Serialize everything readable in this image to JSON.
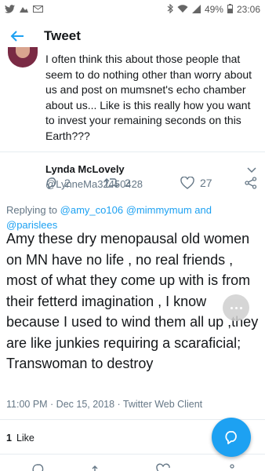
{
  "status_bar": {
    "time": "23:06",
    "battery": "49%",
    "left_icons": [
      "twitter-icon",
      "image-icon",
      "mail-icon"
    ],
    "right_icons": [
      "bluetooth-icon",
      "wifi-icon",
      "signal-icon",
      "battery-icon"
    ]
  },
  "header": {
    "title": "Tweet"
  },
  "previous_tweet": {
    "text": "I often think this about those people that seem to do nothing other than worry about us and post on mumsnet's echo chamber about us... Like is this really how you want to invest your remaining seconds on this Earth???",
    "reply_count": "2",
    "retweet_count": "2",
    "like_count": "27"
  },
  "tweet": {
    "author_name": "Lynda McLovely",
    "author_handle": "@LynneMa32450428",
    "replying_prefix": "Replying to",
    "replying_to": [
      "@amy_co106",
      "@mimmymum",
      "@parislees"
    ],
    "replying_and": "and",
    "text": "Amy these dry menopausal old women on MN have no life , no real friends , most of what they come up with is from their fetterd imagination , I know because I used to wind them all up ,they are like junkies requiring a scaraficial; Transwoman to destroy",
    "timestamp": "11:00 PM · Dec 15, 2018 · Twitter Web Client",
    "likes_count": "1",
    "likes_label": "Like"
  },
  "colors": {
    "accent": "#1da1f2",
    "text": "#14171a",
    "secondary": "#657786",
    "divider": "#e6ecf0"
  }
}
